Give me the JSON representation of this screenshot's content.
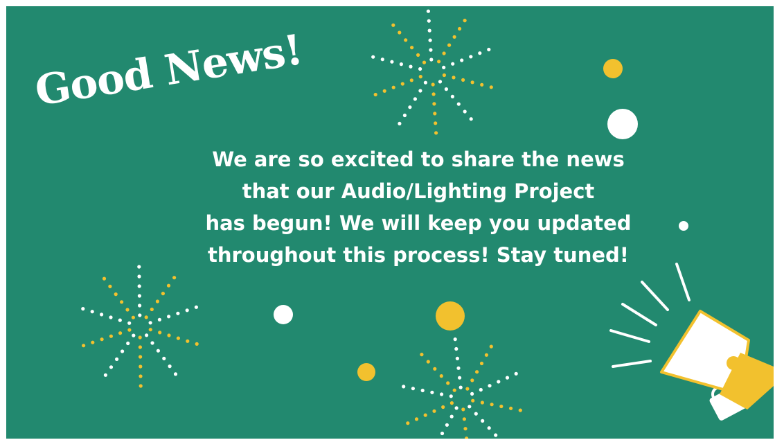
{
  "headline": "Good News!",
  "message": "We are so excited to share the news\nthat our Audio/Lighting Project\nhas begun! We will keep you updated\nthroughout this process!  Stay tuned!",
  "colors": {
    "background": "#22896f",
    "accent_yellow": "#f2c12e",
    "white": "#ffffff"
  },
  "icons": [
    "firework-burst",
    "firework-burst",
    "firework-burst",
    "confetti-dot",
    "megaphone-icon"
  ]
}
